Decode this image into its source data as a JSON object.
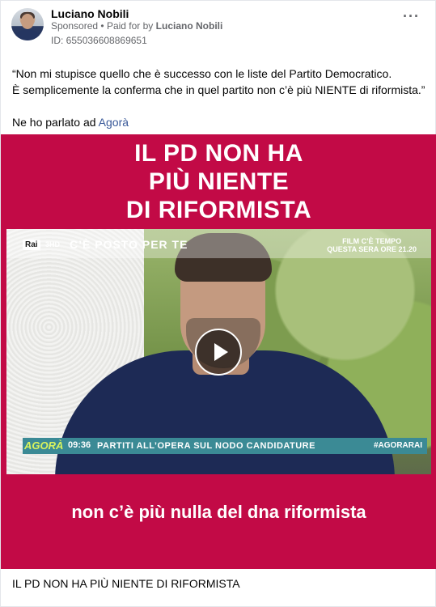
{
  "post": {
    "author": "Luciano Nobili",
    "sponsored": "Sponsored",
    "separator": "•",
    "paid_prefix": "Paid for by",
    "paid_by": "Luciano Nobili",
    "ad_id": "ID: 655036608869651",
    "more_icon": "more-horizontal-icon",
    "text_line1": "“Non mi stupisce quello che è successo con le liste del Partito Democratico.",
    "text_line2": "È semplicemente la conferma che in quel partito non c’è più NIENTE di riformista.”",
    "text_line3_prefix": "Ne ho parlato ad",
    "text_line3_link": "Agorà"
  },
  "video": {
    "headline_line1": "IL PD NON HA",
    "headline_line2": "PIÙ NIENTE",
    "headline_line3": "DI RIFORMISTA",
    "channel_logo": "Rai",
    "channel_num": "3HD",
    "show_title": "C’È POSTO PER TE",
    "promo_line1": "FILM C’È TEMPO",
    "promo_line2": "QUESTA SERA ORE 21.20",
    "ticker_logo": "AGORÀ",
    "ticker_time": "09:36",
    "ticker_text": "PARTITI ALL’OPERA SUL NODO CANDIDATURE",
    "ticker_tag": "#AGORARAI",
    "caption": "non c’è più nulla del dna riformista",
    "play_icon": "play-icon",
    "background_color": "#c20a46"
  },
  "footer": {
    "title": "IL PD NON HA PIÙ NIENTE DI RIFORMISTA"
  }
}
